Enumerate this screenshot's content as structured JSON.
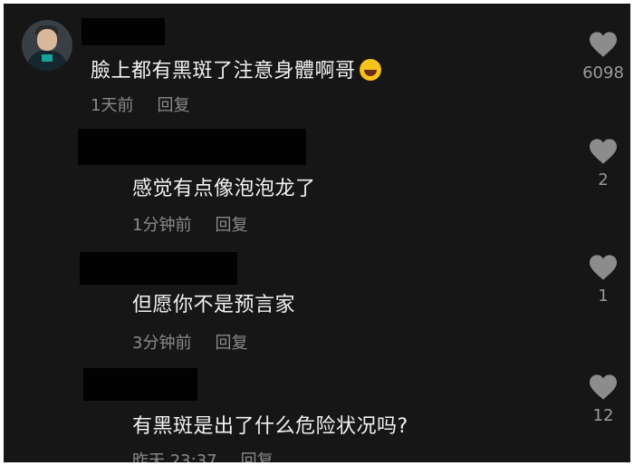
{
  "comments": [
    {
      "text": "臉上都有黑斑了注意身體啊哥",
      "emoji": "laughing-emoji",
      "time": "1天前",
      "reply_label": "回复",
      "likes": "6098"
    },
    {
      "text": "感觉有点像泡泡龙了",
      "time": "1分钟前",
      "reply_label": "回复",
      "likes": "2"
    },
    {
      "text": "但愿你不是预言家",
      "time": "3分钟前",
      "reply_label": "回复",
      "likes": "1"
    },
    {
      "text": "有黑斑是出了什么危险状况吗?",
      "time": "昨天 23:37",
      "reply_label": "回复",
      "likes": "12"
    }
  ],
  "colors": {
    "background": "#161616",
    "text": "#f1f1f1",
    "meta": "#8a8a8a",
    "heart": "#8c8c8c",
    "redaction": "#020202"
  }
}
